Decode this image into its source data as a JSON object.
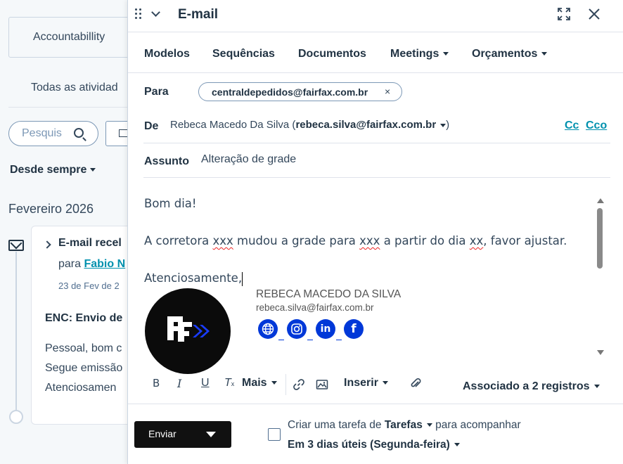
{
  "background": {
    "tab_label": "Accountabillity",
    "sub_label": "Todas as atividad",
    "search_placeholder": "Pesquis",
    "filter_label": "Desde sempre",
    "month_label": "Fevereiro 2026",
    "card": {
      "title": "E-mail recel",
      "to_prefix": "para",
      "to_name": "Fabio N",
      "date": "23 de Fev de 2",
      "subject": "ENC: Envio de",
      "line1": "Pessoal, bom c",
      "line2": "Segue emissão",
      "line3": "Atenciosamen"
    }
  },
  "composer": {
    "title": "E-mail",
    "tabs": [
      {
        "label": "Modelos"
      },
      {
        "label": "Sequências"
      },
      {
        "label": "Documentos"
      },
      {
        "label": "Meetings"
      },
      {
        "label": "Orçamentos"
      }
    ],
    "to": {
      "label": "Para",
      "recipient": "centraldepedidos@fairfax.com.br",
      "remove_glyph": "×"
    },
    "from": {
      "label": "De",
      "name": "Rebeca Macedo Da Silva",
      "email": "rebeca.silva@fairfax.com.br"
    },
    "cc_label": "Cc",
    "cco_label": "Cco",
    "subject": {
      "label": "Assunto",
      "value": "Alteração de grade"
    },
    "body": {
      "greeting": "Bom dia!",
      "message_parts": [
        "A corretora ",
        "xxx",
        " mudou a grade para ",
        "xxx",
        " a partir do dia ",
        "xx",
        ", favor ajustar."
      ],
      "closing": "Atenciosamente,"
    },
    "signature": {
      "logo_text": "FF",
      "name": "REBECA MACEDO DA SILVA",
      "email": "rebeca.silva@fairfax.com.br",
      "social_icons": [
        "globe-icon",
        "instagram-icon",
        "linkedin-icon",
        "facebook-icon"
      ]
    },
    "toolbar": {
      "bold": "B",
      "italic": "I",
      "underline": "U",
      "clear_format": "T",
      "more": "Mais",
      "insert": "Inserir",
      "associated": "Associado a 2 registros"
    },
    "footer": {
      "send_label": "Enviar",
      "task_prefix": "Criar uma tarefa de",
      "task_type": "Tarefas",
      "task_suffix": "para acompanhar",
      "task_due": "Em 3 dias úteis (Segunda-feira)"
    }
  },
  "colors": {
    "link": "#0091ae",
    "social_blue": "#0038d8",
    "send_button": "#111111",
    "logo_bg": "#0b0b0b"
  }
}
